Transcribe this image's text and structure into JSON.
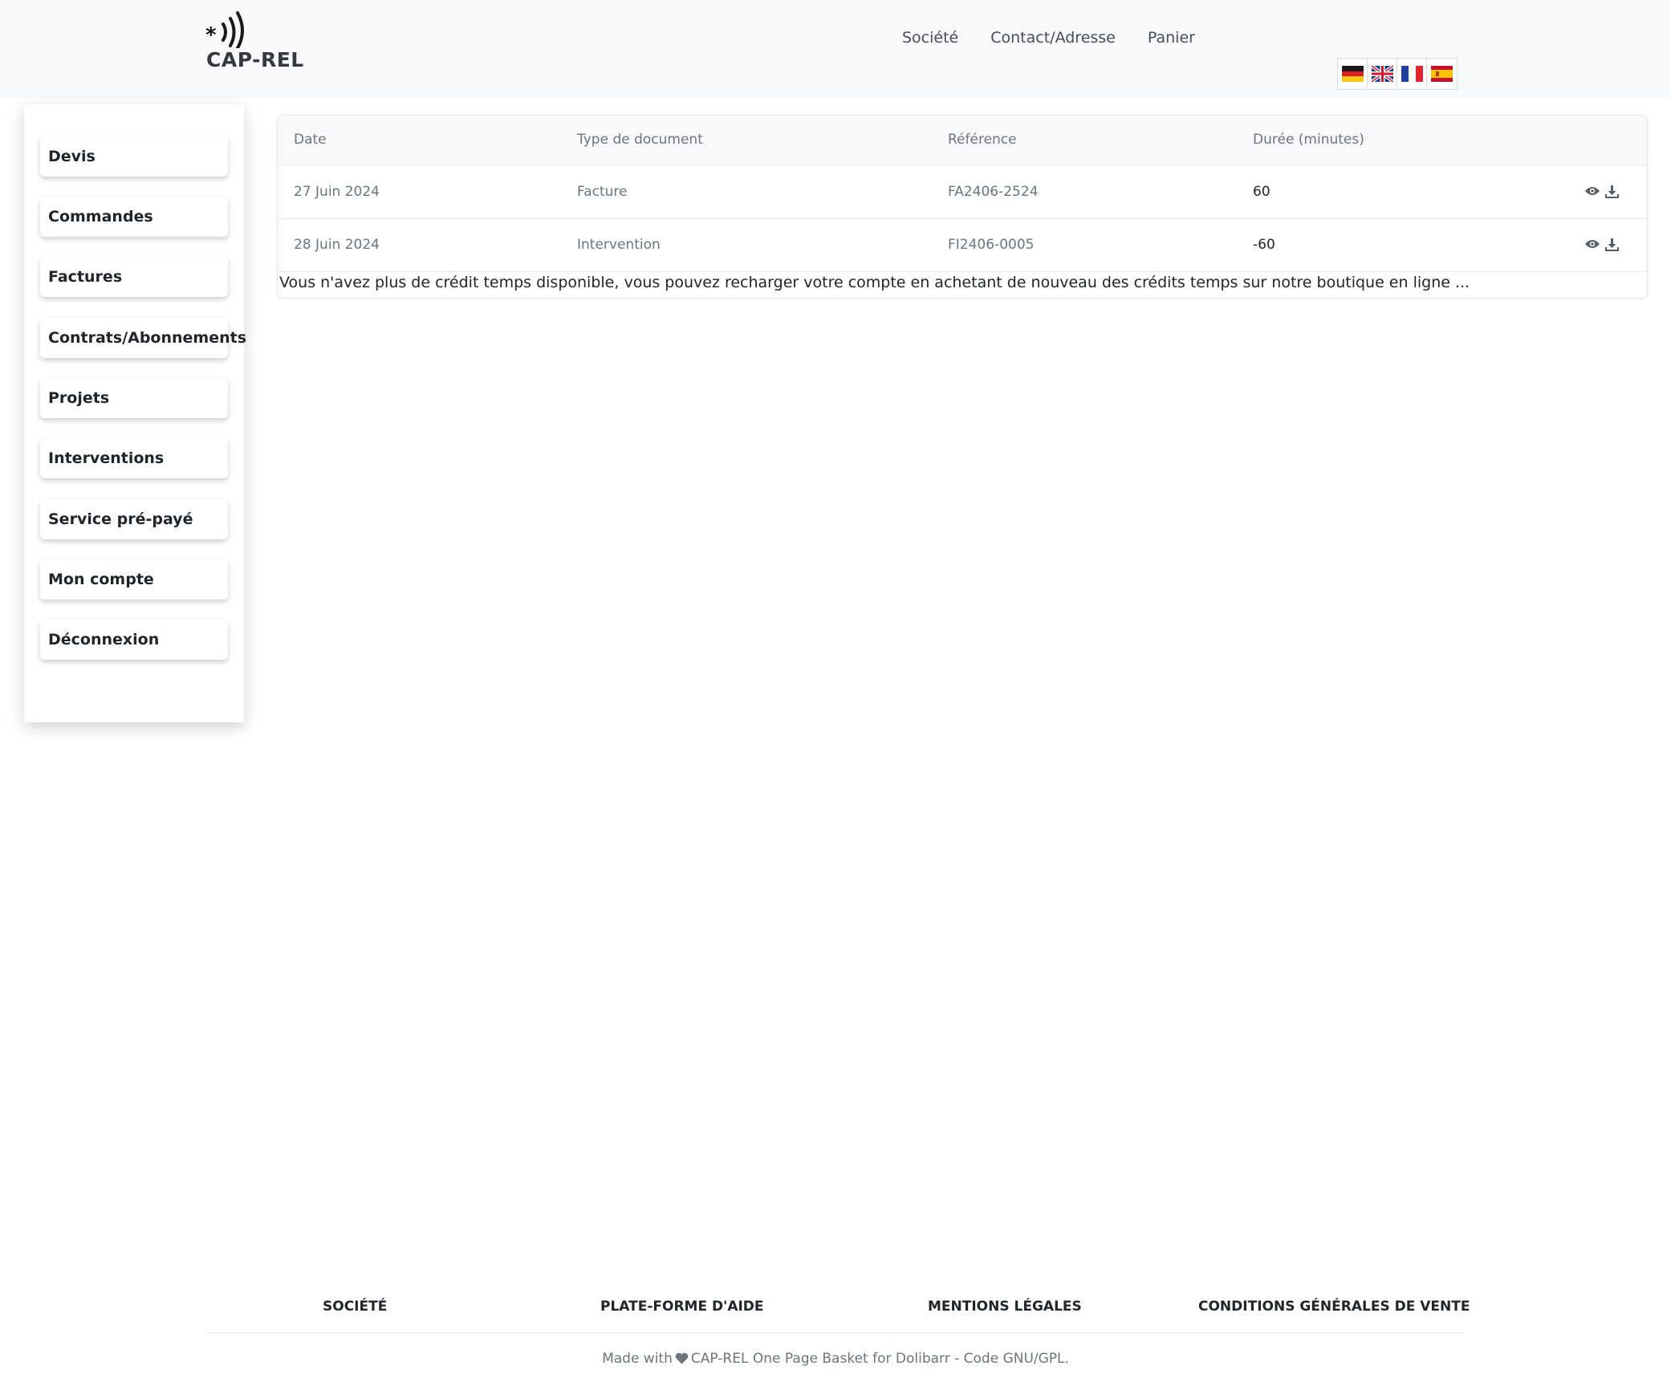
{
  "header": {
    "brand": "CAP-REL",
    "nav": [
      "Société",
      "Contact/Adresse",
      "Panier"
    ],
    "languages": [
      {
        "code": "de",
        "icon": "flag-germany-icon"
      },
      {
        "code": "en",
        "icon": "flag-uk-icon"
      },
      {
        "code": "fr",
        "icon": "flag-france-icon"
      },
      {
        "code": "es",
        "icon": "flag-spain-icon"
      }
    ]
  },
  "sidebar": {
    "items": [
      "Devis",
      "Commandes",
      "Factures",
      "Contrats/Abonnements",
      "Projets",
      "Interventions",
      "Service pré-payé",
      "Mon compte",
      "Déconnexion"
    ]
  },
  "table": {
    "columns": [
      "Date",
      "Type de document",
      "Référence",
      "Durée (minutes)"
    ],
    "rows": [
      {
        "date": "27 Juin 2024",
        "type": "Facture",
        "reference": "FA2406-2524",
        "duration": "60"
      },
      {
        "date": "28 Juin 2024",
        "type": "Intervention",
        "reference": "FI2406-0005",
        "duration": "-60"
      }
    ],
    "row_actions": [
      "view-icon",
      "download-icon"
    ],
    "notice": "Vous n'avez plus de crédit temps disponible, vous pouvez recharger votre compte en achetant de nouveau des crédits temps sur notre boutique en ligne ..."
  },
  "footer": {
    "links": [
      "SOCIÉTÉ",
      "PLATE-FORME D'AIDE",
      "MENTIONS LÉGALES",
      "CONDITIONS GÉNÉRALES DE VENTE"
    ],
    "credit_prefix": "Made with",
    "credit_suffix": "CAP-REL One Page Basket for Dolibarr - Code GNU/GPL."
  },
  "colors": {
    "header_bg": "#f8f9fa",
    "text": "#212529",
    "muted": "#6c757d"
  }
}
